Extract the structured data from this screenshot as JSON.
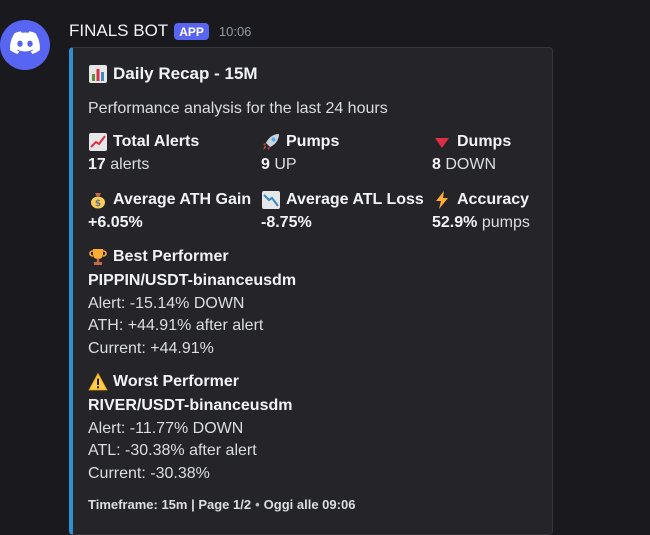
{
  "message": {
    "username": "FINALS BOT",
    "badge": "APP",
    "timestamp": "10:06",
    "avatar_icon": "discord-logo-icon"
  },
  "colors": {
    "embed_accent": "#2f8fd3",
    "app_badge": "#5865f2",
    "avatar_bg": "#5865f2"
  },
  "embed": {
    "title": "Daily Recap - 15M",
    "title_icon": "bar-chart-icon",
    "description": "Performance analysis for the last 24 hours",
    "fields": [
      {
        "icon": "chart-increasing-icon",
        "name": "Total Alerts",
        "value_bold": "17",
        "value_rest": " alerts"
      },
      {
        "icon": "rocket-icon",
        "name": "Pumps",
        "value_bold": "9",
        "value_rest": " UP"
      },
      {
        "icon": "red-triangle-down-icon",
        "name": "Dumps",
        "value_bold": "8",
        "value_rest": " DOWN"
      },
      {
        "icon": "money-bag-icon",
        "name": "Average ATH Gain",
        "value_bold": "+6.05%",
        "value_rest": ""
      },
      {
        "icon": "chart-decreasing-icon",
        "name": "Average ATL Loss",
        "value_bold": "-8.75%",
        "value_rest": ""
      },
      {
        "icon": "lightning-icon",
        "name": "Accuracy",
        "value_bold": "52.9%",
        "value_rest": " pumps"
      }
    ],
    "best": {
      "icon": "trophy-icon",
      "name": "Best Performer",
      "pair": "PIPPIN/USDT-binanceusdm",
      "alert": "Alert: -15.14% DOWN",
      "extreme": "ATH: +44.91% after alert",
      "current": "Current: +44.91%"
    },
    "worst": {
      "icon": "warning-icon",
      "name": "Worst Performer",
      "pair": "RIVER/USDT-binanceusdm",
      "alert": "Alert: -11.77% DOWN",
      "extreme": "ATL: -30.38% after alert",
      "current": "Current: -30.38%"
    },
    "footer": {
      "text": "Timeframe: 15m | Page 1/2",
      "separator": "•",
      "time": "Oggi alle 09:06"
    }
  }
}
